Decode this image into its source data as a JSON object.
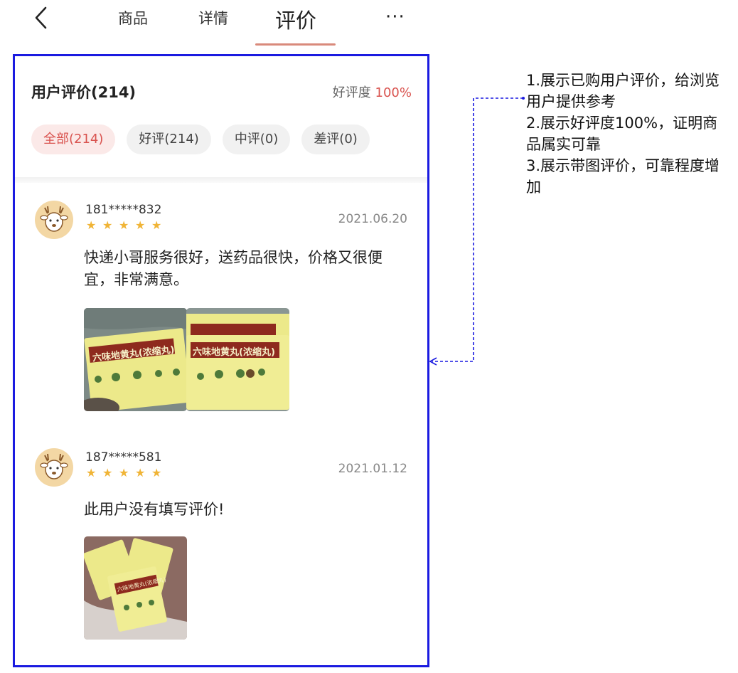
{
  "nav": {
    "tabs": [
      "商品",
      "详情",
      "评价"
    ],
    "active_tab": "评价",
    "more_label": "···"
  },
  "reviews_header": {
    "title": "用户评价(214)",
    "rate_label": "好评度",
    "rate_value": "100%"
  },
  "filters": [
    "全部(214)",
    "好评(214)",
    "中评(0)",
    "差评(0)"
  ],
  "reviews": [
    {
      "user": "181*****832",
      "date": "2021.06.20",
      "rating": 5,
      "text": "快递小哥服务很好，送药品很快，价格又很便宜，非常满意。",
      "photos": [
        "六味地黄丸(浓缩丸)",
        "六味地黄丸(浓缩丸)"
      ]
    },
    {
      "user": "187*****581",
      "date": "2021.01.12",
      "rating": 5,
      "text": "此用户没有填写评价!",
      "photos": [
        "六味地黄丸(浓缩丸)"
      ]
    }
  ],
  "annotation": {
    "lines": [
      "1.展示已购用户评价，给浏览用户提供参考",
      "2.展示好评度100%，证明商品属实可靠",
      "3.展示带图评价，可靠程度增加"
    ]
  },
  "colors": {
    "accent_red": "#d9534f",
    "outline_blue": "#1a1ae0",
    "star": "#f0b436"
  },
  "icons": [
    "back-arrow-icon",
    "more-icon",
    "star-icon",
    "deer-avatar-icon"
  ]
}
